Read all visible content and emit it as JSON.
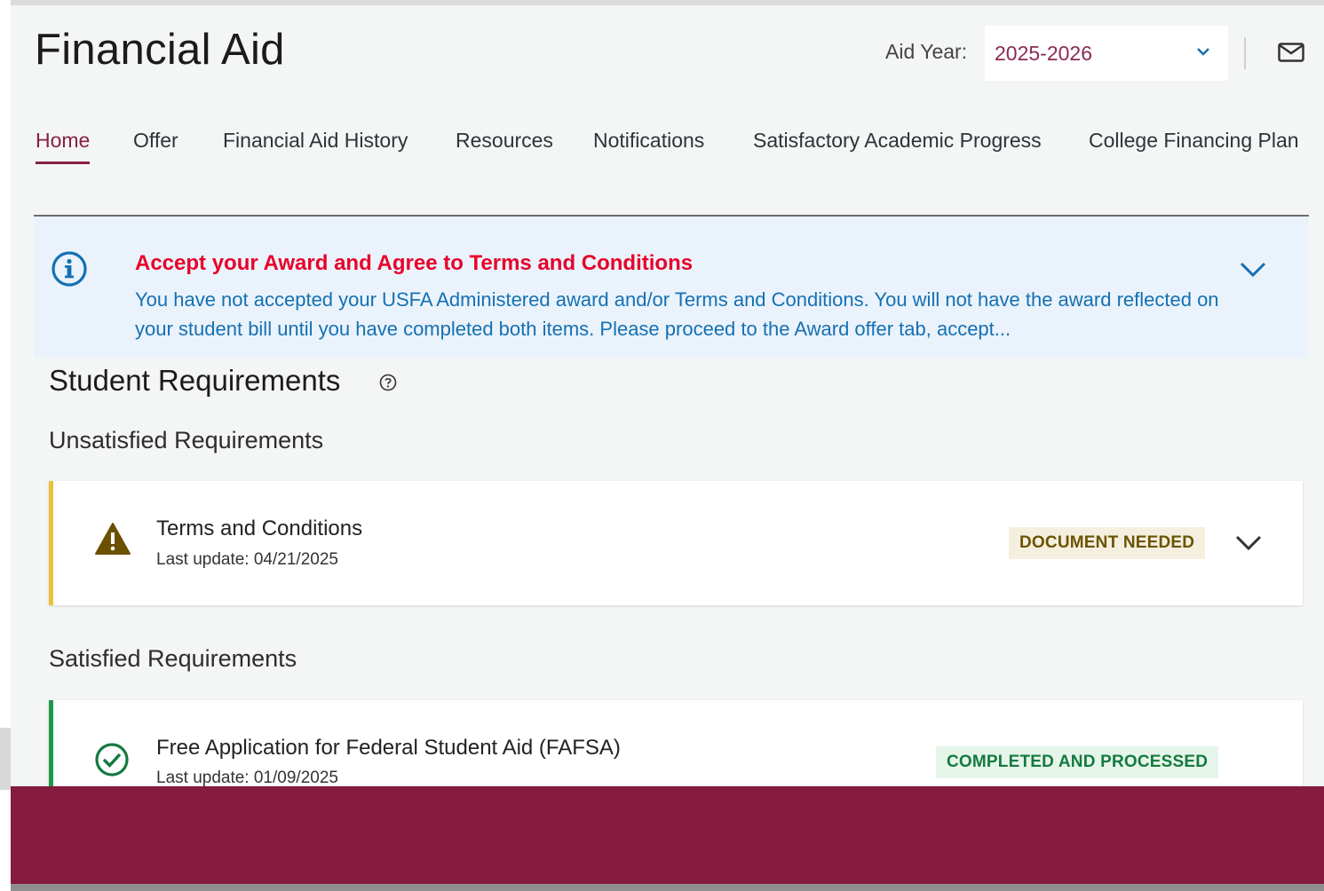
{
  "header": {
    "title": "Financial Aid",
    "aid_year_label": "Aid Year:",
    "aid_year_value": "2025-2026"
  },
  "tabs": [
    {
      "label": "Home",
      "active": true
    },
    {
      "label": "Offer"
    },
    {
      "label": "Financial Aid History"
    },
    {
      "label": "Resources"
    },
    {
      "label": "Notifications"
    },
    {
      "label": "Satisfactory Academic Progress"
    },
    {
      "label": "College Financing Plan"
    }
  ],
  "alert": {
    "title": "Accept your Award and Agree to Terms and Conditions",
    "body": "You have not accepted your USFA Administered award and/or Terms and Conditions. You will not have the award reflected on your student bill until you have completed both items. Please proceed to the Award offer tab, accept..."
  },
  "requirements": {
    "section_title": "Student Requirements",
    "unsatisfied_label": "Unsatisfied Requirements",
    "satisfied_label": "Satisfied Requirements",
    "unsatisfied": [
      {
        "name": "Terms and Conditions",
        "last_update": "Last update: 04/21/2025",
        "status": "DOCUMENT NEEDED"
      }
    ],
    "satisfied": [
      {
        "name": "Free Application for Federal Student Aid (FAFSA)",
        "last_update": "Last update: 01/09/2025",
        "status": "COMPLETED AND PROCESSED"
      }
    ]
  },
  "colors": {
    "brand": "#851b3f",
    "alert_title": "#e8002a",
    "alert_body": "#1670b3",
    "warning": "#e9c13a",
    "success": "#1c9a48"
  }
}
